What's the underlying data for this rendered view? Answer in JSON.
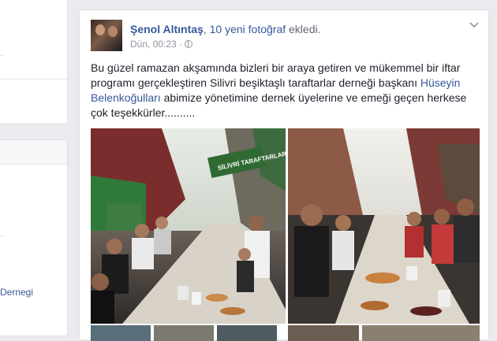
{
  "left_column": {
    "group_link": "Dernegi"
  },
  "post": {
    "author": "Şenol Altıntaş",
    "comma": ",",
    "photo_count_link": "10 yeni fotoğraf",
    "action_suffix": "ekledi.",
    "timestamp": "Dün, 00:23",
    "separator": "·",
    "body_part1": "Bu güzel ramazan akşamında bizleri bir araya getiren ve mükemmel bir iftar programı gerçekleştiren Silivri beşiktaşlı taraftarlar derneği başkanı ",
    "mention": "Hüseyin Belenkoğulları",
    "body_part2": " abimize yönetimine dernek üyelerine ve emeği geçen herkese çok teşekkürler..........",
    "banner_text": "SİLİVRİ TARAFTARLAR",
    "photos": [
      "iftar-street-table-photo-1",
      "iftar-street-table-photo-2",
      "photo-3",
      "photo-4",
      "photo-5",
      "photo-6",
      "photo-7"
    ]
  },
  "colors": {
    "link": "#365899",
    "meta": "#90949c",
    "background": "#e9ebee"
  }
}
